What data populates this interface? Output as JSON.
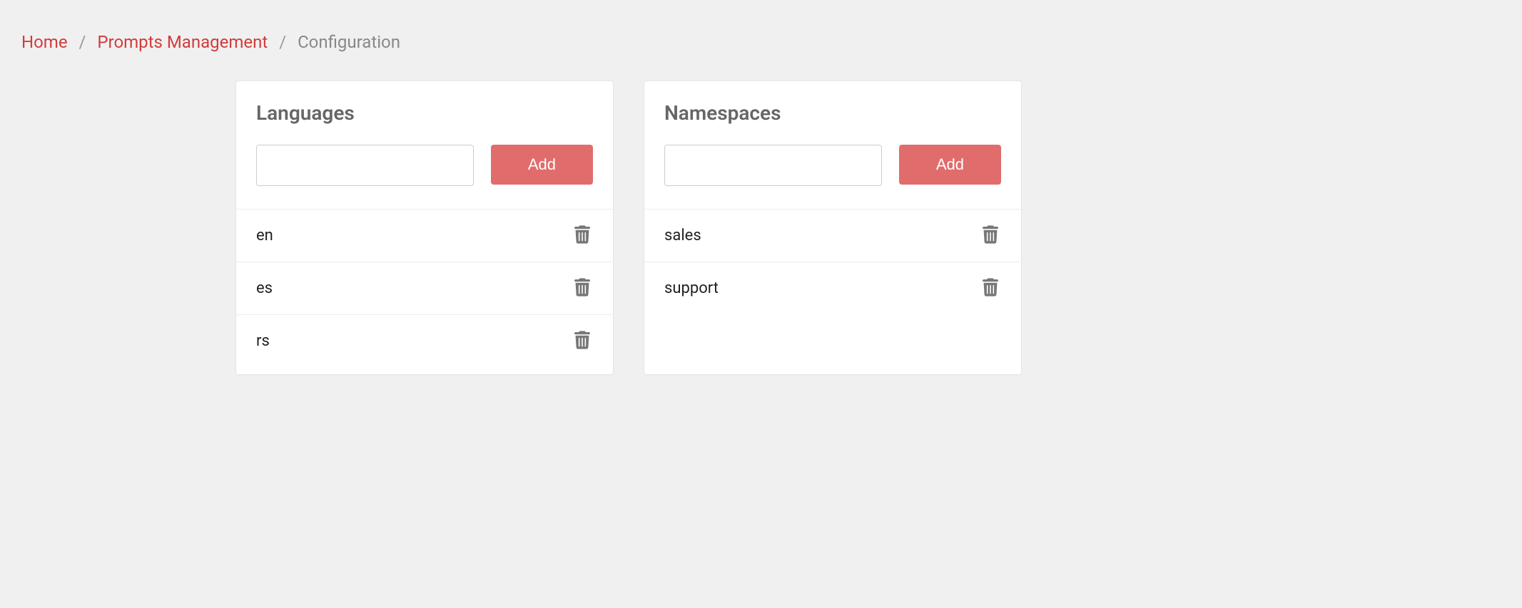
{
  "breadcrumb": {
    "home": "Home",
    "prompts": "Prompts Management",
    "current": "Configuration"
  },
  "cards": {
    "languages": {
      "title": "Languages",
      "add_label": "Add",
      "input_value": "",
      "items": [
        {
          "label": "en"
        },
        {
          "label": "es"
        },
        {
          "label": "rs"
        }
      ]
    },
    "namespaces": {
      "title": "Namespaces",
      "add_label": "Add",
      "input_value": "",
      "items": [
        {
          "label": "sales"
        },
        {
          "label": "support"
        }
      ]
    }
  }
}
